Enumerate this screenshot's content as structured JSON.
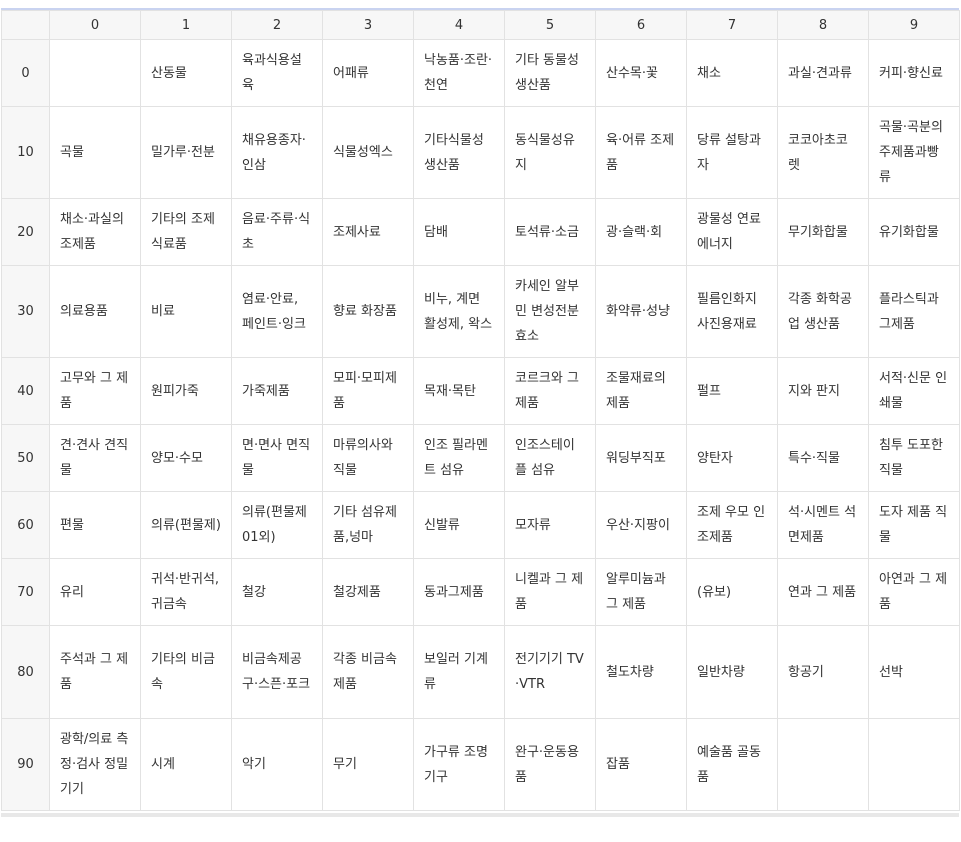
{
  "table": {
    "headers": [
      "",
      "0",
      "1",
      "2",
      "3",
      "4",
      "5",
      "6",
      "7",
      "8",
      "9"
    ],
    "rows": [
      {
        "label": "0",
        "cells": [
          "",
          "산동물",
          "육과식용설육",
          "어패류",
          "낙농품·조란·천연",
          "기타 동물성 생산품",
          "산수목·꽃",
          "채소",
          "과실·견과류",
          "커피·향신료"
        ]
      },
      {
        "label": "10",
        "cells": [
          "곡물",
          "밀가루·전분",
          "채유용종자·인삼",
          "식물성엑스",
          "기타식물성 생산품",
          "동식물성유지",
          "육·어류 조제품",
          "당류 설탕과자",
          "코코아초코렛",
          "곡물·곡분의 주제품과빵류"
        ]
      },
      {
        "label": "20",
        "cells": [
          "채소·과실의 조제품",
          "기타의 조제 식료품",
          "음료·주류·식초",
          "조제사료",
          "담배",
          "토석류·소금",
          "광·슬랙·회",
          "광물성 연료 에너지",
          "무기화합물",
          "유기화합물"
        ]
      },
      {
        "label": "30",
        "cells": [
          "의료용품",
          "비료",
          "염료·안료, 페인트·잉크",
          "향료 화장품",
          "비누, 계면 활성제, 왁스",
          "카세인 알부민 변성전분 효소",
          "화약류·성냥",
          "필름인화지 사진용재료",
          "각종 화학공업 생산품",
          "플라스틱과 그제품"
        ]
      },
      {
        "label": "40",
        "cells": [
          "고무와 그 제품",
          "원피가죽",
          "가죽제품",
          "모피·모피제품",
          "목재·목탄",
          "코르크와 그 제품",
          "조물재료의 제품",
          "펄프",
          "지와 판지",
          "서적·신문 인쇄물"
        ]
      },
      {
        "label": "50",
        "cells": [
          "견·견사 견직물",
          "양모·수모",
          "면·면사 면직물",
          "마류의사와 직물",
          "인조 필라멘트 섬유",
          "인조스테이플 섬유",
          "워딩부직포",
          "양탄자",
          "특수·직물",
          "침투 도포한 직물"
        ]
      },
      {
        "label": "60",
        "cells": [
          "편물",
          "의류(편물제)",
          "의류(편물제01외)",
          "기타 섬유제품,넝마",
          "신발류",
          "모자류",
          "우산·지팡이",
          "조제 우모 인조제품",
          "석·시멘트 석면제품",
          "도자 제품 직물"
        ]
      },
      {
        "label": "70",
        "cells": [
          "유리",
          "귀석·반귀석,귀금속",
          "철강",
          "철강제품",
          "동과그제품",
          "니켈과 그 제품",
          "알루미늄과 그 제품",
          "(유보)",
          "연과 그 제품",
          "아연과 그 제품"
        ]
      },
      {
        "label": "80",
        "cells": [
          "주석과 그 제품",
          "기타의 비금속",
          "비금속제공구·스픈·포크",
          "각종 비금속제품",
          "보일러 기계류",
          "전기기기 TV·VTR",
          "철도차량",
          "일반차량",
          "항공기",
          "선박"
        ]
      },
      {
        "label": "90",
        "cells": [
          "광학/의료 측정·검사 정밀기기",
          "시계",
          "악기",
          "무기",
          "가구류 조명기구",
          "완구·운동용품",
          "잡품",
          "예술품 골동품",
          "",
          ""
        ]
      }
    ]
  }
}
